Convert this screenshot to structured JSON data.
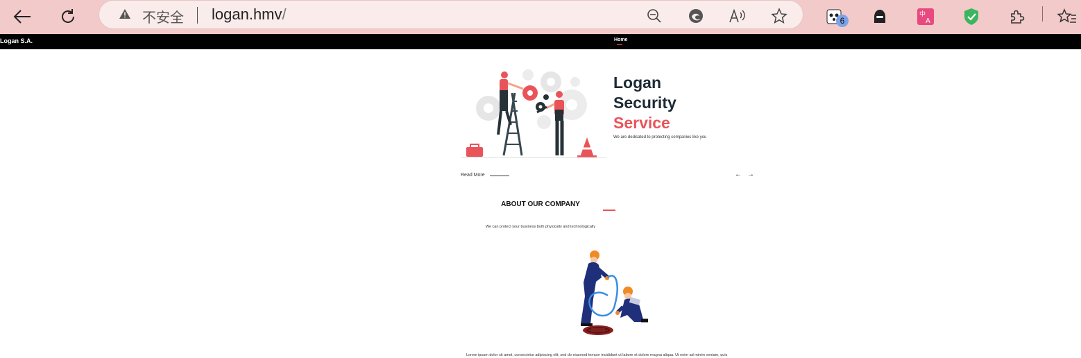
{
  "browser": {
    "security_label": "不安全",
    "url_host": "logan.hmv",
    "url_path": "/",
    "extension_badge_count": "6",
    "icons": [
      "back-icon",
      "reload-icon",
      "warning-icon",
      "zoom-out-icon",
      "edge-icon",
      "read-aloud-icon",
      "favorite-star-icon",
      "extension-panda-icon",
      "extension-hood-icon",
      "extension-translate-icon",
      "extension-shield-icon",
      "extensions-puzzle-icon",
      "favorites-icon"
    ]
  },
  "site": {
    "brand": "Logan S.A.",
    "nav": {
      "home": "Home"
    },
    "hero": {
      "title_line1": "Logan",
      "title_line2": "Security",
      "title_line3": "Service",
      "subtitle": "We are dedicated to protecting companies like you",
      "read_more": "Read More",
      "prev": "←",
      "next": "→"
    },
    "about": {
      "title": "ABOUT OUR COMPANY",
      "subtitle": "We can protect your business both physically and technologically",
      "lorem": "Lorem ipsum dolor sit amet, consectetur adipiscing elit, sed do eiusmod tempor incididunt ut labore et dolore magna aliqua. Ut enim ad minim veniam, quis"
    }
  },
  "colors": {
    "accent": "#e9545a",
    "dark_text": "#1d2a35",
    "toolbar": "#f2caca"
  }
}
